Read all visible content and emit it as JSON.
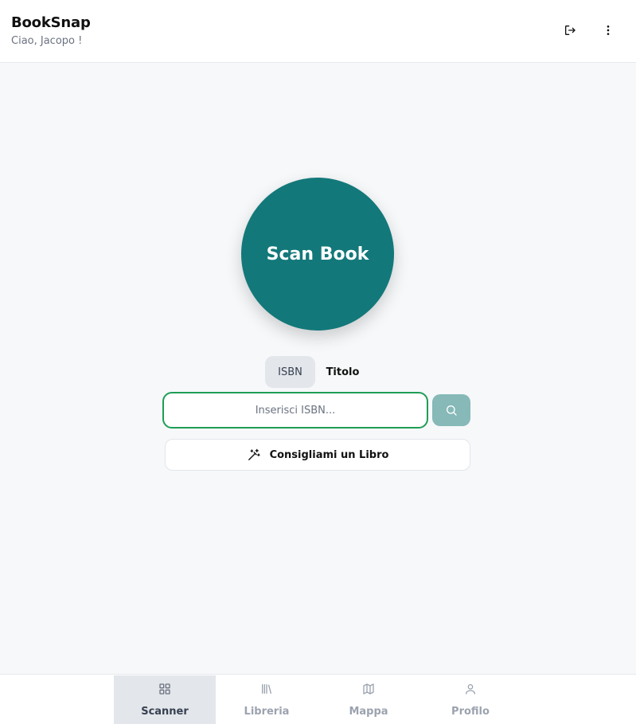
{
  "header": {
    "title": "BookSnap",
    "greeting": "Ciao, Jacopo !",
    "logout_icon": "logout-icon",
    "menu_icon": "more-vertical-icon"
  },
  "scan": {
    "label": "Scan Book"
  },
  "search": {
    "tabs": [
      {
        "label": "ISBN",
        "active": true
      },
      {
        "label": "Titolo",
        "active": false
      }
    ],
    "placeholder": "Inserisci ISBN...",
    "value": "",
    "button_icon": "search-icon"
  },
  "recommend": {
    "label": "Consigliami un Libro",
    "icon": "magic-wand-icon"
  },
  "nav": {
    "items": [
      {
        "label": "Scanner",
        "icon": "grid-icon",
        "active": true
      },
      {
        "label": "Libreria",
        "icon": "library-icon",
        "active": false
      },
      {
        "label": "Mappa",
        "icon": "map-icon",
        "active": false
      },
      {
        "label": "Profilo",
        "icon": "user-icon",
        "active": false
      }
    ]
  },
  "colors": {
    "primary": "#13787a",
    "search_button": "#86b9b8",
    "input_border": "#1f9d55",
    "background": "#f6f8fa"
  }
}
